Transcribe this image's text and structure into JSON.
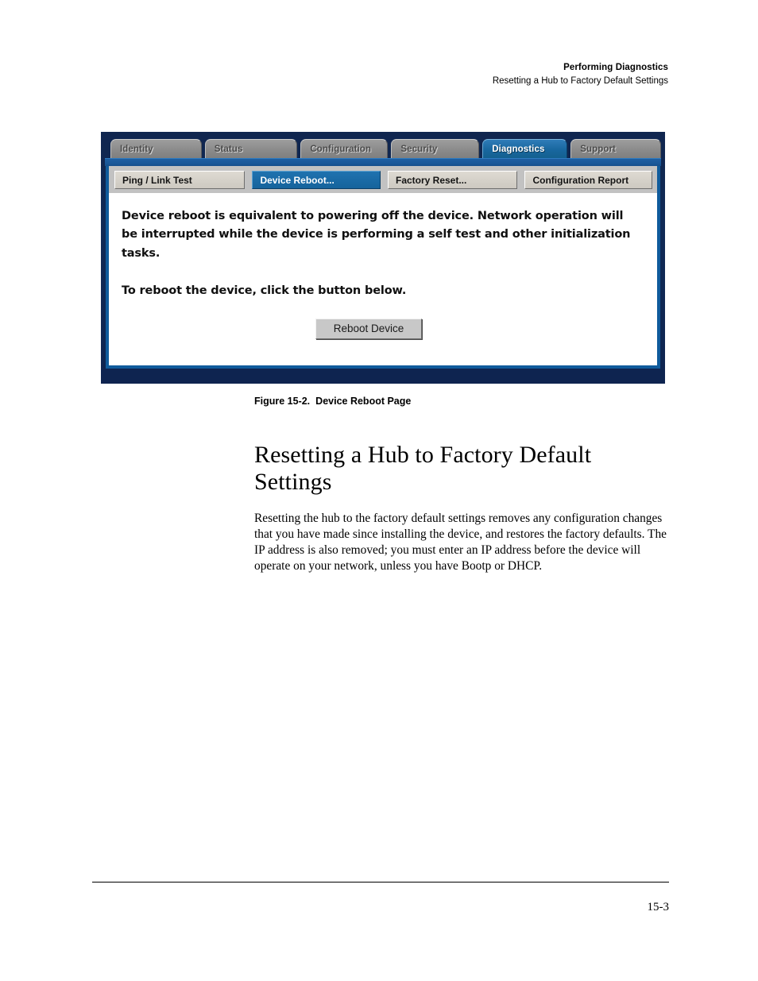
{
  "header": {
    "line1": "Performing Diagnostics",
    "line2": "Resetting a Hub to Factory Default Settings"
  },
  "figure": {
    "caption_number": "Figure 15-2.",
    "caption_title": "Device Reboot Page",
    "tabs": [
      {
        "label": "Identity",
        "active": false
      },
      {
        "label": "Status",
        "active": false
      },
      {
        "label": "Configuration",
        "active": false
      },
      {
        "label": "Security",
        "active": false
      },
      {
        "label": "Diagnostics",
        "active": true
      },
      {
        "label": "Support",
        "active": false
      }
    ],
    "subtabs": [
      {
        "label": "Ping / Link Test",
        "active": false
      },
      {
        "label": "Device Reboot...",
        "active": true
      },
      {
        "label": "Factory Reset...",
        "active": false
      },
      {
        "label": "Configuration Report",
        "active": false
      }
    ],
    "body_paragraph_1": "Device reboot is equivalent to powering off the device. Network operation will be interrupted while the device is performing a self test and other initialization tasks.",
    "body_paragraph_2": "To reboot the device, click the button below.",
    "button_label": "Reboot Device",
    "colors": {
      "frame_outer": "#10264f",
      "frame_inner_border": "#0f5b9c",
      "tab_inactive": "#8e8e8e",
      "tab_active": "#1a6ba8",
      "subtab_bar": "#c2c2c2",
      "button_face": "#c8c8c8"
    }
  },
  "section": {
    "heading": "Resetting a Hub to Factory Default Settings",
    "paragraph": "Resetting the hub to the factory default settings removes any configuration changes that you have made since installing the device, and restores the factory defaults. The IP address is also removed; you must enter an IP address before the device will operate on your network, unless you have Bootp or DHCP."
  },
  "footer": {
    "page_number": "15-3"
  }
}
